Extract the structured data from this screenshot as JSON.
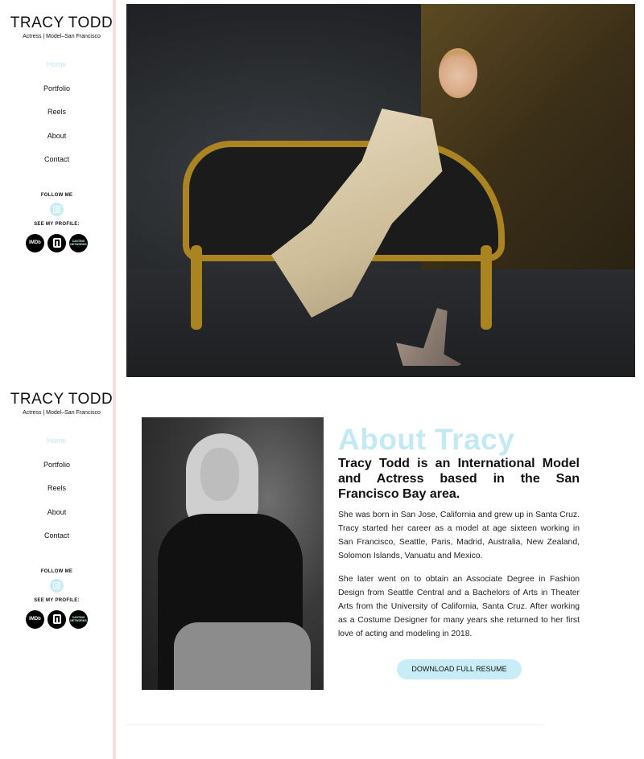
{
  "sidebars": [
    {
      "title": "TRACY TODD",
      "subtitle": "Actress | Model–San Francisco",
      "nav": [
        "Home",
        "Portfolio",
        "Reels",
        "About",
        "Contact"
      ],
      "follow_label": "FOLLOW ME",
      "profile_label": "SEE MY PROFILE:",
      "profiles": [
        "IMDb",
        "Backstage",
        "Casting Networks"
      ]
    },
    {
      "title": "TRACY TODD",
      "subtitle": "Actress | Model–San Francisco",
      "nav": [
        "Home",
        "Portfolio",
        "Reels",
        "About",
        "Contact"
      ],
      "follow_label": "FOLLOW ME",
      "profile_label": "SEE MY PROFILE:",
      "profiles": [
        "IMDb",
        "Backstage",
        "Casting Networks"
      ]
    }
  ],
  "profile_badges": {
    "imdb": "IMDb",
    "casting": "CASTING NETWORKS"
  },
  "about": {
    "heading": "About Tracy",
    "lead": "Tracy Todd is an International Model and Actress based in the San Francisco Bay area.",
    "paragraph1": "She was born in San Jose, California and grew up in Santa Cruz. Tracy started her career as a model at age sixteen working in San Francisco, Seattle, Paris, Madrid, Australia, New Zealand, Solomon Islands, Vanuatu and Mexico.",
    "paragraph2": "She later went on to obtain an Associate Degree in Fashion Design from Seattle Central and a Bachelors of Arts in Theater Arts from the University of California, Santa Cruz. After working as a Costume Designer for many years she returned to her first love of acting and modeling in 2018.",
    "button": "DOWNLOAD FULL RESUME"
  },
  "colors": {
    "accent": "#c3e9f2",
    "divider": "#f5dede",
    "text": "#111111"
  },
  "icons": {
    "social": "instagram-icon",
    "profiles": [
      "imdb-icon",
      "backstage-icon",
      "casting-networks-icon"
    ]
  }
}
